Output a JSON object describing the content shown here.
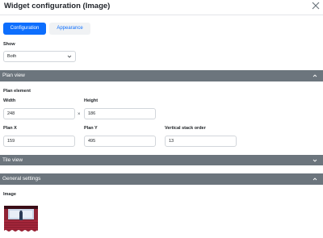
{
  "dialog": {
    "title": "Widget configuration (Image)"
  },
  "tabs": [
    {
      "label": "Configuration",
      "active": true
    },
    {
      "label": "Appearance",
      "active": false
    }
  ],
  "show": {
    "label": "Show",
    "value": "Both"
  },
  "plan_view": {
    "header": "Plan view",
    "expanded": true,
    "element_label": "Plan element",
    "width_label": "Width",
    "width_value": "248",
    "times": "×",
    "height_label": "Height",
    "height_value": "186",
    "plan_x_label": "Plan X",
    "plan_x_value": "159",
    "plan_y_label": "Plan Y",
    "plan_y_value": "495",
    "stack_label": "Vertical stack order",
    "stack_value": "13"
  },
  "tile_view": {
    "header": "Tile view",
    "expanded": false
  },
  "general": {
    "header": "General settings",
    "expanded": true,
    "image_label": "Image"
  },
  "colors": {
    "primary": "#0d6efd",
    "section_bar": "#6c757d"
  }
}
